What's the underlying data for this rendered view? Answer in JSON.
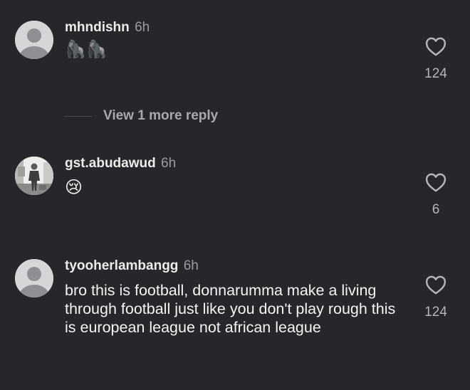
{
  "comments": [
    {
      "username": "mhndishn",
      "time": "6h",
      "text": "🦍🦍",
      "likes": "124",
      "more_replies": "View 1 more reply"
    },
    {
      "username": "gst.abudawud",
      "time": "6h",
      "text": "😢",
      "likes": "6"
    },
    {
      "username": "tyooherlambangg",
      "time": "6h",
      "text": "bro this is football, donnarumma make a living through football just like you don't play rough this is european league not african league",
      "likes": "124"
    }
  ],
  "icons": {
    "like": "heart-outline-icon",
    "avatar_default": "default-avatar-icon"
  },
  "colors": {
    "background": "#26272b",
    "username": "#ececec",
    "timestamp": "#9a9aa0",
    "like_count": "#b5b5ba"
  }
}
